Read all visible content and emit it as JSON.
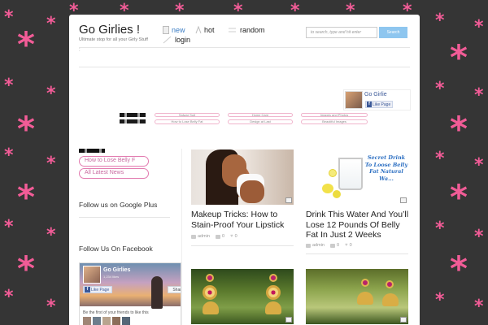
{
  "site": {
    "title": "Go Girlies !",
    "tagline": "Ultimate stop for all your Girly Stuff",
    "mark": ":"
  },
  "nav": {
    "items": [
      {
        "label": "new",
        "active": true
      },
      {
        "label": "hot",
        "active": false
      },
      {
        "label": "random",
        "active": false
      },
      {
        "label": "login",
        "active": false
      }
    ]
  },
  "search": {
    "placeholder": "to search, type and hit enter",
    "button": "Search"
  },
  "fb_mini": {
    "name": "Go Girlie",
    "like": "Like Page"
  },
  "tags": {
    "top": [
      "Salwar Suit",
      "Home Care",
      "Images and Photos"
    ],
    "bottom": [
      "How to Lose Belly Fat",
      "Design at Last",
      "Beautiful Images"
    ]
  },
  "sidebar": {
    "pills": [
      "How to Lose Belly F",
      "All Latest News"
    ],
    "google_heading": "Follow us on Google Plus",
    "facebook_heading": "Follow Us On Facebook",
    "fb_page": {
      "name": "Go Girlies",
      "meta": "1,234 likes",
      "like": "Like Page",
      "share": "Share",
      "friends": "Be the first of your friends to like this"
    }
  },
  "posts": [
    {
      "title": "Makeup Tricks: How to Stain-Proof Your Lipstick",
      "author": "admin",
      "comments": "0",
      "likes": "0"
    },
    {
      "title": "Drink This Water And You’ll Lose 12 Pounds Of Belly Fat In Just 2 Weeks",
      "author": "admin",
      "comments": "0",
      "likes": "0",
      "image_text": "Secret Drink To Loose Belly Fat Natural Wa..."
    },
    {
      "title": "",
      "author": "",
      "comments": "",
      "likes": ""
    },
    {
      "title": "",
      "author": "",
      "comments": "",
      "likes": ""
    }
  ],
  "colors": {
    "background": "#353535",
    "star": "#f25c97",
    "nav_active": "#3b7dc4",
    "search_button": "#8ec6ef",
    "pill_border": "#e27bb0",
    "facebook": "#3b5998"
  },
  "icons": [
    "star-pattern",
    "new-icon",
    "hot-icon",
    "random-icon",
    "login-icon",
    "comment-icon",
    "heart-icon",
    "user-icon",
    "expand-icon"
  ]
}
